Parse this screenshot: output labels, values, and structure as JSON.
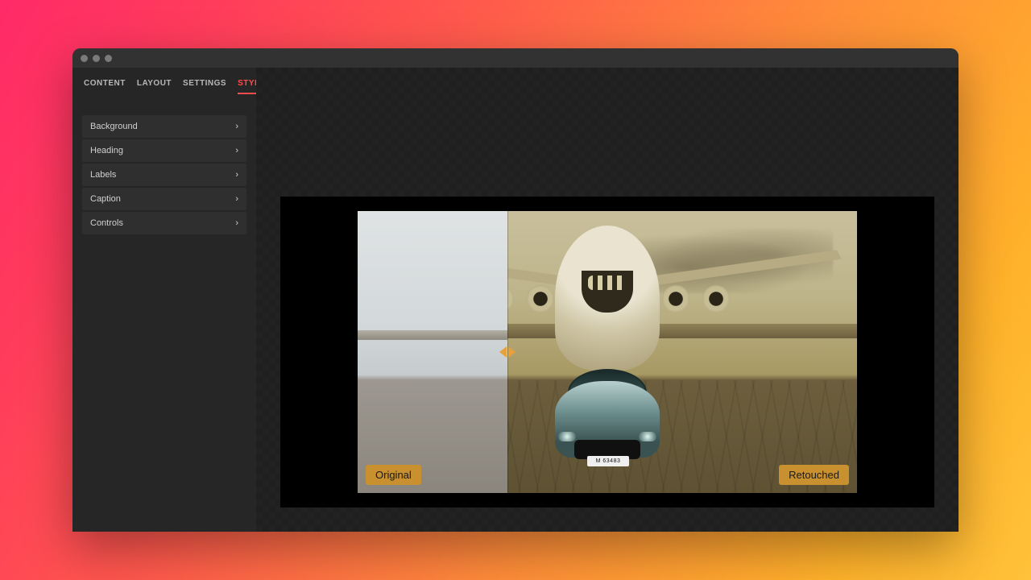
{
  "tabs": [
    "CONTENT",
    "LAYOUT",
    "SETTINGS",
    "STYLE"
  ],
  "active_tab_index": 3,
  "menu": [
    {
      "label": "Background"
    },
    {
      "label": "Heading"
    },
    {
      "label": "Labels"
    },
    {
      "label": "Caption"
    },
    {
      "label": "Controls"
    }
  ],
  "compare": {
    "left_label": "Original",
    "right_label": "Retouched",
    "plate_text": "M 63483",
    "slider_position_pct": 30
  },
  "colors": {
    "accent": "#ff4d4d",
    "badge_bg": "#c8902f",
    "handle": "#e6a13a"
  }
}
